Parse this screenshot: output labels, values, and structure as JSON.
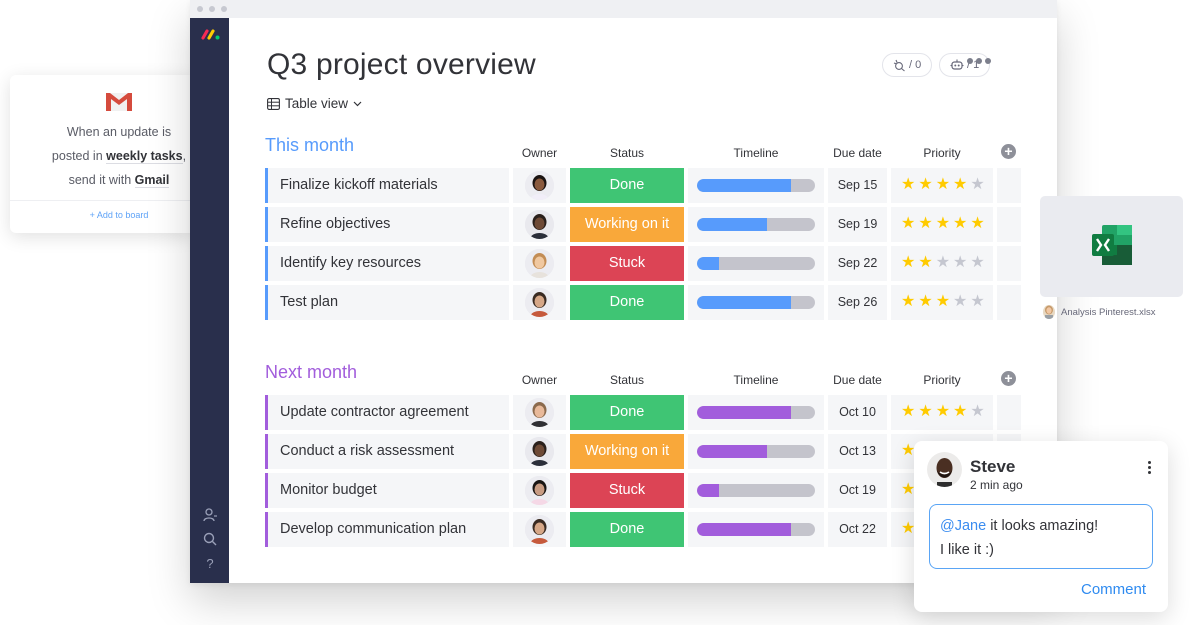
{
  "window": {
    "title": "Q3 project overview",
    "view_label": "Table view",
    "pills": [
      {
        "icon": "integration-icon",
        "value": "/ 0"
      },
      {
        "icon": "automation-robot-icon",
        "value": "/ 1"
      }
    ]
  },
  "colors": {
    "sidebar": "#292f4c",
    "done": "#3fc574",
    "working": "#f9a83a",
    "stuck": "#dc4455",
    "group1": "#579bfc",
    "group2": "#a25ddc",
    "track": "#c4c4cc",
    "star_on": "#ffcb00",
    "star_off": "#c5c7d0"
  },
  "columns": [
    "Owner",
    "Status",
    "Timeline",
    "Due date",
    "Priority"
  ],
  "groups": [
    {
      "title": "This month",
      "color": "#579bfc",
      "rows": [
        {
          "name": "Finalize kickoff materials",
          "status": "Done",
          "status_color": "#3fc574",
          "timeline_progress": 0.8,
          "due": "Sep 15",
          "priority": 4
        },
        {
          "name": "Refine objectives",
          "status": "Working on it",
          "status_color": "#f9a83a",
          "timeline_progress": 0.59,
          "due": "Sep 19",
          "priority": 5
        },
        {
          "name": "Identify key resources",
          "status": "Stuck",
          "status_color": "#dc4455",
          "timeline_progress": 0.19,
          "due": "Sep 22",
          "priority": 2
        },
        {
          "name": "Test plan",
          "status": "Done",
          "status_color": "#3fc574",
          "timeline_progress": 0.8,
          "due": "Sep 26",
          "priority": 3
        }
      ]
    },
    {
      "title": "Next month",
      "color": "#a25ddc",
      "rows": [
        {
          "name": "Update contractor agreement",
          "status": "Done",
          "status_color": "#3fc574",
          "timeline_progress": 0.8,
          "due": "Oct 10",
          "priority": 4
        },
        {
          "name": "Conduct a risk assessment",
          "status": "Working on it",
          "status_color": "#f9a83a",
          "timeline_progress": 0.59,
          "due": "Oct 13",
          "priority": 5
        },
        {
          "name": "Monitor budget",
          "status": "Stuck",
          "status_color": "#dc4455",
          "timeline_progress": 0.19,
          "due": "Oct 19",
          "priority": 2
        },
        {
          "name": "Develop communication plan",
          "status": "Done",
          "status_color": "#3fc574",
          "timeline_progress": 0.8,
          "due": "Oct 22",
          "priority": 3
        }
      ]
    }
  ],
  "gmail_card": {
    "line1": "When an update is",
    "line2_prefix": "posted in ",
    "line2_bold": "weekly tasks",
    "line2_suffix": ",",
    "line3_prefix": "send it with ",
    "line3_bold": "Gmail",
    "add_label": "+ Add to board"
  },
  "file_card": {
    "filename": "Analysis Pinterest.xlsx",
    "file_type": "excel-icon"
  },
  "comment_card": {
    "author": "Steve",
    "time": "2 min ago",
    "mention": "@Jane",
    "text_line1": " it looks amazing!",
    "text_line2": "I like it :)",
    "button_label": "Comment"
  },
  "sidebar": {
    "icons": [
      "invite-user-icon",
      "search-icon",
      "help-icon"
    ],
    "help_glyph": "?"
  }
}
